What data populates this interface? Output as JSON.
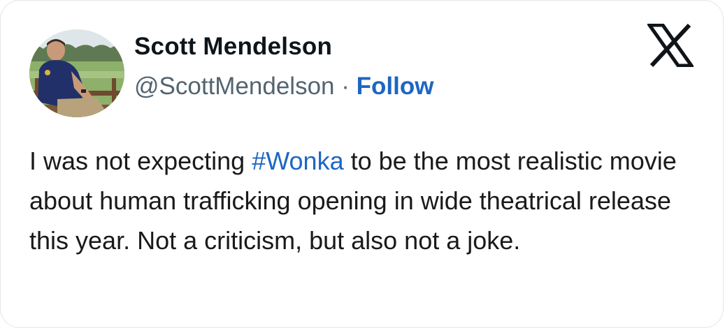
{
  "author": {
    "name": "Scott Mendelson",
    "handle": "@ScottMendelson",
    "separator": " · ",
    "follow_label": "Follow"
  },
  "platform": {
    "icon": "x-logo-icon"
  },
  "tweet": {
    "text_before": "I was not expecting ",
    "hashtag": "#Wonka",
    "text_after": " to be the most realistic movie about human trafficking opening in wide theatrical release this year. Not a criticism, but also not a joke."
  },
  "colors": {
    "link": "#1d66c4",
    "text": "#0f1419",
    "muted": "#536471"
  }
}
